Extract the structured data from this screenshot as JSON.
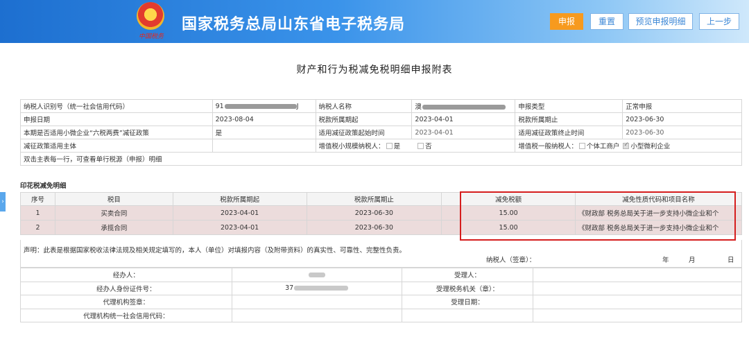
{
  "header": {
    "site_title": "国家税务总局山东省电子税务局",
    "emblem_caption": "中国税务",
    "buttons": {
      "declare": "申报",
      "reset": "重置",
      "preview": "预览申报明细",
      "prev": "上一步"
    }
  },
  "side_tab": "›",
  "page_title": "财产和行为税减免税明细申报附表",
  "info": {
    "taxpayer_id_label": "纳税人识别号（统一社会信用代码）",
    "taxpayer_id_value": "91",
    "taxpayer_id_tail": "J",
    "taxpayer_name_label": "纳税人名称",
    "taxpayer_name_value": "澳",
    "declare_type_label": "申报类型",
    "declare_type_value": "正常申报",
    "declare_date_label": "申报日期",
    "declare_date_value": "2023-08-04",
    "period_start_label": "税款所属期起",
    "period_start_value": "2023-04-01",
    "period_end_label": "税款所属期止",
    "period_end_value": "2023-06-30",
    "six_tax_label": "本期是否适用小微企业“六税两费”减征政策",
    "six_tax_value": "是",
    "policy_start_label": "适用减征政策起始时间",
    "policy_start_value": "2023-04-01",
    "policy_end_label": "适用减征政策终止时间",
    "policy_end_value": "2023-06-30",
    "policy_subject_label": "减征政策适用主体",
    "small_vat_label": "增值税小规模纳税人：",
    "opt_yes": "是",
    "opt_no": "否",
    "general_vat_label": "增值税一般纳税人：",
    "opt_individual": "个体工商户",
    "opt_micro": "小型微利企业",
    "hint": "双击主表每一行，可查看单行税源（申报）明细"
  },
  "section_title": "印花税减免明细",
  "detail": {
    "headers": [
      "序号",
      "税目",
      "税款所属期起",
      "税款所属期止",
      "减免税额",
      "减免性质代码和项目名称"
    ],
    "rows": [
      {
        "no": "1",
        "item": "买卖合同",
        "start": "2023-04-01",
        "end": "2023-06-30",
        "amount": "15.00",
        "code": "《财政部 税务总局关于进一步支持小微企业和个"
      },
      {
        "no": "2",
        "item": "承揽合同",
        "start": "2023-04-01",
        "end": "2023-06-30",
        "amount": "15.00",
        "code": "《财政部 税务总局关于进一步支持小微企业和个"
      }
    ]
  },
  "declaration": {
    "statement": "声明：此表是根据国家税收法律法规及相关规定填写的，本人（单位）对填报内容（及附带资料）的真实性、可靠性、完整性负责。",
    "signature": "纳税人（签章）：",
    "year": "年",
    "month": "月",
    "day": "日"
  },
  "agent": {
    "handler_label": "经办人：",
    "receiver_label": "受理人：",
    "handler_id_label": "经办人身份证件号：",
    "handler_id_value": "37",
    "tax_office_label": "受理税务机关（章）：",
    "agency_seal_label": "代理机构签章：",
    "accept_date_label": "受理日期：",
    "agency_code_label": "代理机构统一社会信用代码："
  },
  "colors": {
    "header_blue": "#1d6fd0",
    "primary_orange": "#f79a1e",
    "highlight_red": "#d51d1d",
    "row_pink": "#ecdcdc"
  }
}
